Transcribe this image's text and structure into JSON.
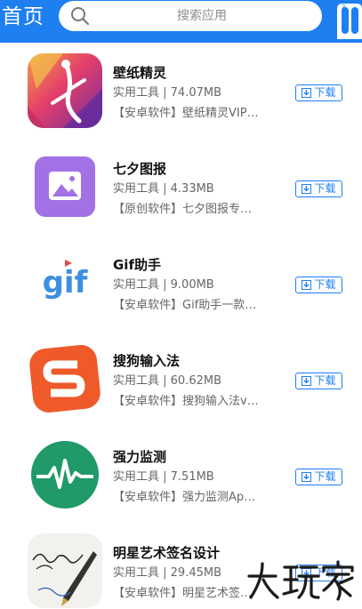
{
  "header": {
    "title": "首页",
    "search_placeholder": "搜索应用",
    "accent_color": "#1d7ff0"
  },
  "apps": [
    {
      "name": "壁纸精灵",
      "meta": "实用工具 | 74.07MB",
      "desc": "【安卓软件】壁纸精灵VIP…",
      "download_label": "下载",
      "icon": "wallpaper-spirit-icon"
    },
    {
      "name": "七夕图报",
      "meta": "实用工具 | 4.33MB",
      "desc": "【原创软件】七夕图报专…",
      "download_label": "下载",
      "icon": "qixi-picture-icon"
    },
    {
      "name": "Gif助手",
      "meta": "实用工具 | 9.00MB",
      "desc": "【安卓软件】Gif助手一款…",
      "download_label": "下载",
      "icon": "gif-helper-icon"
    },
    {
      "name": "搜狗输入法",
      "meta": "实用工具 | 60.62MB",
      "desc": "【安卓软件】搜狗输入法v…",
      "download_label": "下载",
      "icon": "sogou-input-icon"
    },
    {
      "name": "强力监测",
      "meta": "实用工具 | 7.51MB",
      "desc": "【安卓软件】强力监测Ap…",
      "download_label": "下载",
      "icon": "monitor-icon"
    },
    {
      "name": "明星艺术签名设计",
      "meta": "实用工具 | 29.45MB",
      "desc": "【安卓软件】明星艺术签…",
      "download_label": "下载",
      "icon": "signature-design-icon"
    }
  ],
  "watermark": "大玩家"
}
